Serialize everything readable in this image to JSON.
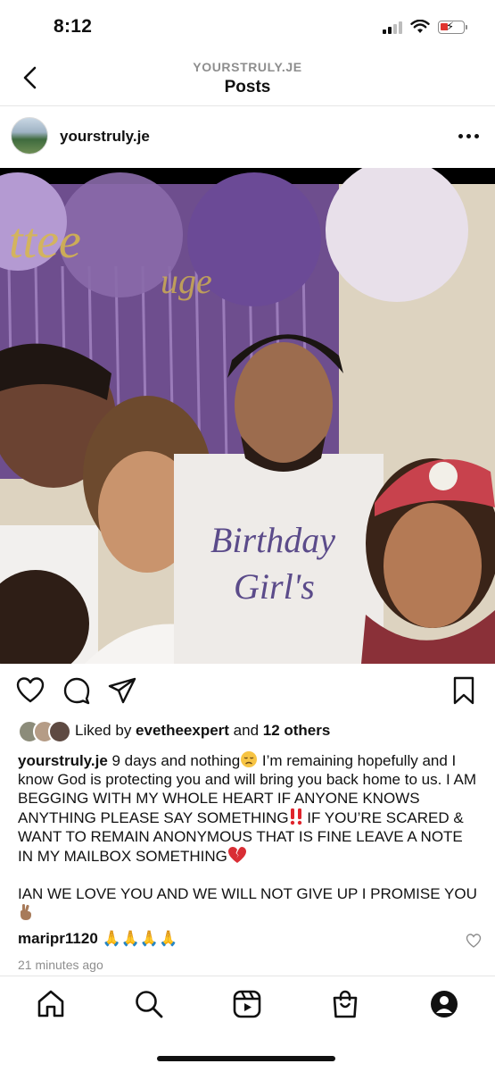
{
  "status_bar": {
    "time": "8:12"
  },
  "nav": {
    "username": "YOURSTRULY.JE",
    "title": "Posts"
  },
  "post": {
    "username": "yourstruly.je",
    "photo_text": {
      "shirt_line1": "Birthday",
      "shirt_line2": "Girl's"
    }
  },
  "likes": {
    "prefix": "Liked by ",
    "user": "evetheexpert",
    "middle": " and ",
    "others": "12 others"
  },
  "caption": {
    "username": "yourstruly.je",
    "part1": " 9 days and nothing",
    "part2": " I’m remaining hopefully and I know God is protecting you and will bring you back home to us. I AM BEGGING WITH MY WHOLE HEART IF ANYONE KNOWS ANYTHING PLEASE SAY SOMETHING",
    "part3": " IF YOU’RE SCARED & WANT TO REMAIN ANONYMOUS THAT IS FINE LEAVE A NOTE IN MY MAILBOX SOMETHING",
    "para2": "IAN WE LOVE YOU AND WE WILL NOT GIVE UP I PROMISE YOU",
    "emoji": {
      "sad": "disappointed-face",
      "alert": "double-exclamation",
      "heart": "broken-heart",
      "fingers": "crossed-fingers"
    }
  },
  "comment": {
    "username": "maripr1120",
    "text": " 🙏🙏🙏🙏"
  },
  "timestamp": "21 minutes ago",
  "colors": {
    "text": "#111111",
    "secondary": "#8e8e8e",
    "battery_low": "#e0342f",
    "divider": "#e6e6e6"
  }
}
